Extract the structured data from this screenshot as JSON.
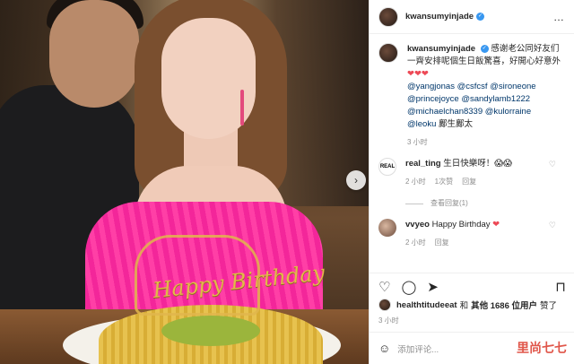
{
  "post": {
    "username": "kwansumyinjade",
    "verified_mark": "✓",
    "more_icon": "…",
    "photo_topper_text": "Happy Birthday"
  },
  "caption": {
    "username": "kwansumyinjade",
    "text": "感谢老公同好友们一齊安排呢個生日飯驚喜，好開心好意外",
    "hearts": "❤❤❤",
    "mentions": [
      "@yangjonas",
      "@csfcsf",
      "@sironeone",
      "@princejoyce",
      "@sandylamb1222",
      "@michaelchan8339",
      "@kulorraine",
      "@leoku"
    ],
    "tail": "鄺生鄺太",
    "time": "3 小时"
  },
  "comments": [
    {
      "avatar_text": "REAL",
      "username": "real_ting",
      "text": "生日快樂呀！😱😱",
      "line2": "😱😱",
      "time": "2 小时",
      "likes": "1次赞",
      "reply": "回复",
      "view_replies": "查看回复(1)"
    },
    {
      "username": "vvyeo",
      "text": "Happy Birthday",
      "heart": "❤",
      "time": "2 小时",
      "reply": "回复"
    }
  ],
  "likes": {
    "liker": "healthtitudeeat",
    "connector": "和",
    "others": "其他 1686 位用户",
    "suffix": "赞了"
  },
  "post_time": "3 小时",
  "add_comment": {
    "placeholder": "添加评论..."
  },
  "watermark": "里尚七七"
}
